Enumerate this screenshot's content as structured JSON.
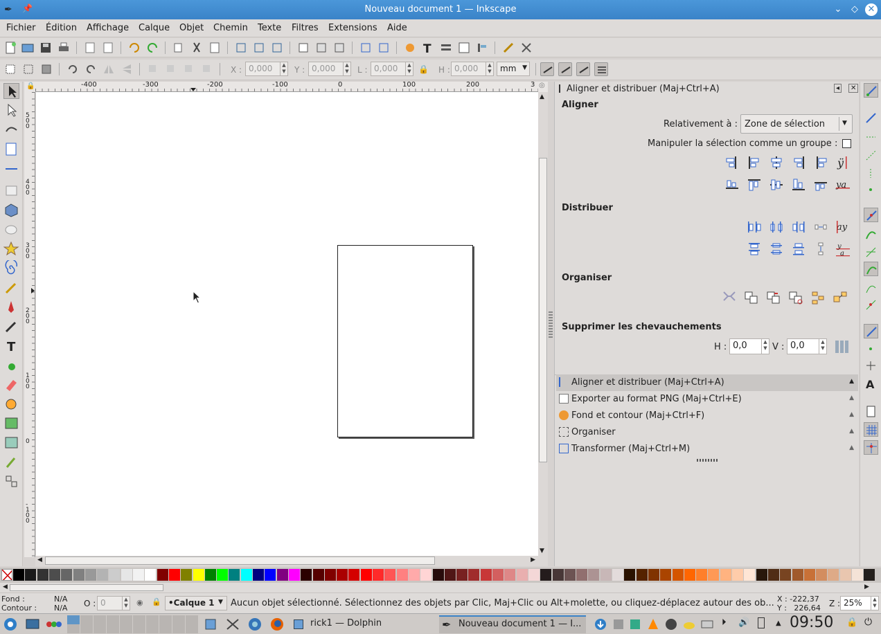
{
  "window": {
    "title": "Nouveau document 1 — Inkscape"
  },
  "menu": [
    "Fichier",
    "Édition",
    "Affichage",
    "Calque",
    "Objet",
    "Chemin",
    "Texte",
    "Filtres",
    "Extensions",
    "Aide"
  ],
  "controls": {
    "x_label": "X :",
    "x_value": "0,000",
    "y_label": "Y :",
    "y_value": "0,000",
    "w_label": "L :",
    "w_value": "0,000",
    "h_label": "H :",
    "h_value": "0,000",
    "unit": "mm"
  },
  "ruler_h": [
    "-400",
    "-300",
    "-200",
    "-100",
    "0",
    "100",
    "200",
    "3"
  ],
  "ruler_v": [
    "5\n0\n0",
    "4\n0\n0",
    "3\n0\n0",
    "2\n0\n0",
    "1\n0\n0",
    "0",
    "-\n1\n0\n0"
  ],
  "dock": {
    "title": "Aligner et distribuer (Maj+Ctrl+A)",
    "align_heading": "Aligner",
    "relative_label": "Relativement à :",
    "relative_value": "Zone de sélection",
    "group_label": "Manipuler la sélection comme un groupe :",
    "distribute_heading": "Distribuer",
    "arrange_heading": "Organiser",
    "overlap_heading": "Supprimer les chevauchements",
    "h_label": "H :",
    "h_value": "0,0",
    "v_label": "V :",
    "v_value": "0,0",
    "dialogs": [
      "Aligner et distribuer (Maj+Ctrl+A)",
      "Exporter au format PNG (Maj+Ctrl+E)",
      "Fond et contour (Maj+Ctrl+F)",
      "Organiser",
      "Transformer (Maj+Ctrl+M)"
    ]
  },
  "status": {
    "fill_label": "Fond :",
    "fill_value": "N/A",
    "stroke_label": "Contour :",
    "stroke_value": "N/A",
    "opacity_label": "O :",
    "opacity_value": "0",
    "layer": "•Calque 1",
    "message": "Aucun objet sélectionné. Sélectionnez des objets par Clic, Maj+Clic ou Alt+molette, ou cliquez-déplacez autour des ob...",
    "x_coord": "X : -222,37",
    "y_coord": "Y :   226,64",
    "zoom_label": "Z :",
    "zoom_value": "25%"
  },
  "taskbar": {
    "task1": "rick1 — Dolphin",
    "task2": "Nouveau document 1 — I...",
    "clock": "09:50"
  },
  "colors": {
    "titlebar": "#3a83c8",
    "accent": "#2c6db5"
  }
}
